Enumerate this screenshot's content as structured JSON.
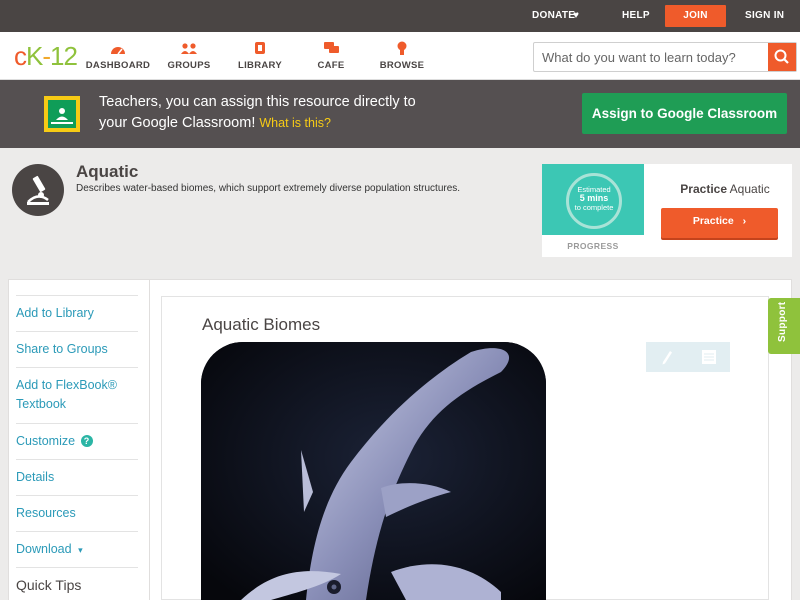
{
  "topbar": {
    "donate": "DONATE",
    "donate_icon": "heart-icon",
    "help": "HELP",
    "join": "JOIN",
    "signin": "SIGN IN"
  },
  "header": {
    "logo_c": "c",
    "logo_k": "K",
    "logo_dash": "-",
    "logo_num": "12",
    "nav": [
      {
        "label": "DASHBOARD",
        "icon": "dashboard-icon"
      },
      {
        "label": "GROUPS",
        "icon": "groups-icon"
      },
      {
        "label": "LIBRARY",
        "icon": "library-icon"
      },
      {
        "label": "CAFE",
        "icon": "cafe-icon"
      },
      {
        "label": "BROWSE",
        "icon": "browse-icon"
      }
    ],
    "search_placeholder": "What do you want to learn today?",
    "search_icon": "search-icon"
  },
  "banner": {
    "text_line1": "Teachers, you can assign this resource directly to",
    "text_line2": "your Google Classroom!",
    "what_link": "What is this?",
    "assign_button": "Assign to Google Classroom"
  },
  "concept": {
    "title": "Aquatic",
    "description": "Describes water-based biomes, which support extremely diverse population structures.",
    "icon": "microscope-icon"
  },
  "practice": {
    "est_line1": "Estimated",
    "est_line2": "5 mins",
    "est_line3": "to complete",
    "progress_label": "PROGRESS",
    "head_bold": "Practice",
    "head_rest": "Aquatic",
    "button": "Practice"
  },
  "sidebar": {
    "items": [
      {
        "label": "Add to Library"
      },
      {
        "label": "Share to Groups"
      },
      {
        "label": "Add to FlexBook® Textbook"
      },
      {
        "label": "Customize"
      },
      {
        "label": "Details"
      },
      {
        "label": "Resources"
      },
      {
        "label": "Download"
      },
      {
        "label": "Quick Tips"
      }
    ],
    "help_glyph": "?",
    "download_caret": "▾"
  },
  "content": {
    "title": "Aquatic Biomes",
    "tool_edit_icon": "pencil-icon",
    "tool_notes_icon": "notes-icon"
  },
  "support": {
    "label": "Support"
  },
  "colors": {
    "accent": "#ef5b2b",
    "green": "#1f9d55",
    "link": "#2b9ab8",
    "support": "#8fc23c"
  }
}
